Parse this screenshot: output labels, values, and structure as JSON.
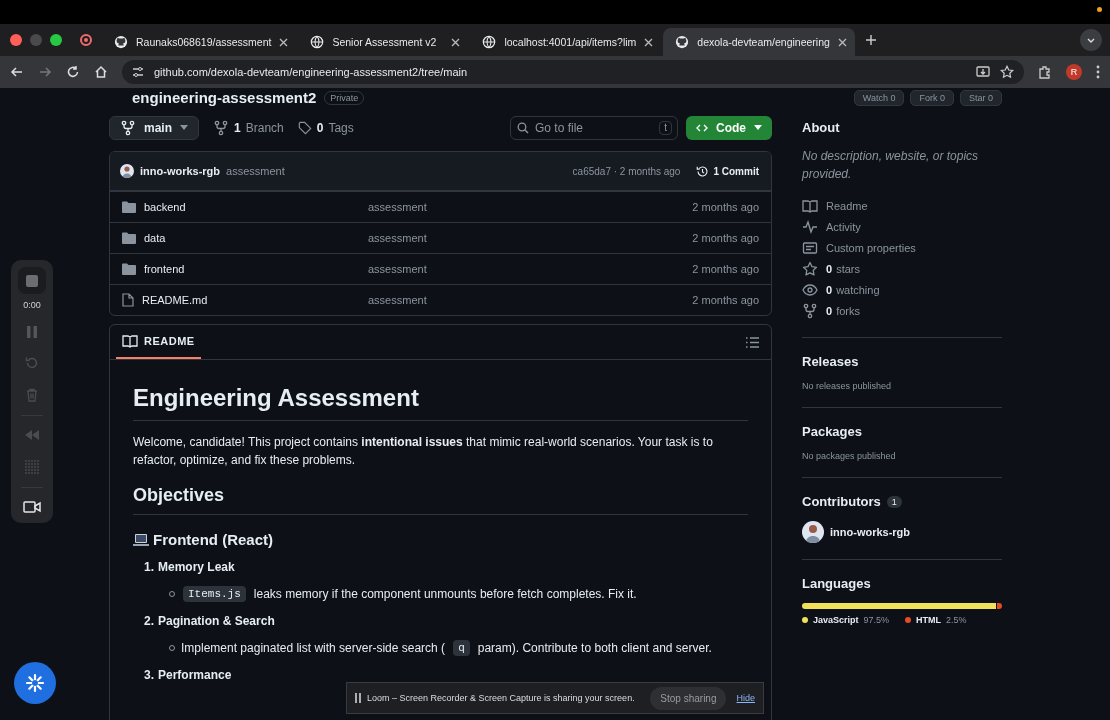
{
  "browser": {
    "tabs": [
      {
        "title": "Raunaks068619/assessment",
        "kind": "github",
        "selected": false
      },
      {
        "title": "Senior Assessment v2",
        "kind": "web",
        "selected": false
      },
      {
        "title": "localhost:4001/api/items?lim",
        "kind": "web",
        "selected": false
      },
      {
        "title": "dexola-devteam/engineering",
        "kind": "github",
        "selected": true
      }
    ],
    "url": "github.com/dexola-devteam/engineering-assessment2/tree/main",
    "profile": "R"
  },
  "repo": {
    "name": "engineering-assessment2",
    "visibility": "Private",
    "actions": [
      {
        "label": "Watch",
        "count": "0"
      },
      {
        "label": "Fork",
        "count": "0"
      },
      {
        "label": "Star",
        "count": "0"
      }
    ],
    "branch": "main",
    "branches": {
      "count": "1",
      "label": "Branch"
    },
    "tags": {
      "count": "0",
      "label": "Tags"
    },
    "search": {
      "placeholder": "Go to file",
      "shortcut": "t"
    },
    "code_button": "Code"
  },
  "commit": {
    "author": "inno-works-rgb",
    "message": "assessment",
    "hash_time": "ca65da7 · 2 months ago",
    "commits": "1 Commit"
  },
  "files": [
    {
      "kind": "dir",
      "name": "backend",
      "message": "assessment",
      "time": "2 months ago"
    },
    {
      "kind": "dir",
      "name": "data",
      "message": "assessment",
      "time": "2 months ago"
    },
    {
      "kind": "dir",
      "name": "frontend",
      "message": "assessment",
      "time": "2 months ago"
    },
    {
      "kind": "file",
      "name": "README.md",
      "message": "assessment",
      "time": "2 months ago"
    }
  ],
  "readme": {
    "tab": "README",
    "title": "Engineering Assessment",
    "intro": "Welcome, candidate! This project contains **intentional issues** that mimic real-world scenarios. Your task is to refactor, optimize, and fix these problems.",
    "section": "Objectives",
    "subsection": "Frontend (React)",
    "items": [
      {
        "number": "1.",
        "title": "Memory Leak",
        "bullets": [
          [
            {
              "kind": "code",
              "text": "Items.js"
            },
            {
              "kind": "text",
              "text": "leaks memory if the component unmounts before fetch completes. Fix it."
            }
          ]
        ]
      },
      {
        "number": "2.",
        "title": "Pagination & Search",
        "bullets": [
          [
            {
              "kind": "text",
              "text": "Implement paginated list with server-side search ("
            },
            {
              "kind": "code",
              "text": "q"
            },
            {
              "kind": "text",
              "text": "param). Contribute to both client and server."
            }
          ]
        ]
      },
      {
        "number": "3.",
        "title": "Performance"
      }
    ]
  },
  "sidebar": {
    "about": {
      "heading": "About",
      "description": "No description, website, or topics provided.",
      "links": [
        {
          "kind": "readme",
          "label": "Readme"
        },
        {
          "kind": "activity",
          "label": "Activity"
        },
        {
          "kind": "properties",
          "label": "Custom properties"
        },
        {
          "kind": "stars",
          "count": "0",
          "label": "stars"
        },
        {
          "kind": "watchers",
          "count": "0",
          "label": "watching"
        },
        {
          "kind": "forks",
          "count": "0",
          "label": "forks"
        }
      ]
    },
    "releases": {
      "heading": "Releases",
      "note": "No releases published"
    },
    "packages": {
      "heading": "Packages",
      "note": "No packages published"
    },
    "contributors": {
      "heading": "Contributors",
      "count": "1",
      "people": [
        "inno-works-rgb"
      ]
    },
    "languages": {
      "heading": "Languages",
      "items": [
        {
          "name": "JavaScript",
          "percent": "97.5%",
          "level": 0.975,
          "color": "#f1e05a"
        },
        {
          "name": "HTML",
          "percent": "2.5%",
          "level": 0.025,
          "color": "#e34c26"
        }
      ]
    }
  },
  "loom": {
    "time": "0:00",
    "share_message": "Loom – Screen Recorder & Screen Capture is sharing your screen.",
    "stop": "Stop sharing",
    "hide": "Hide"
  }
}
